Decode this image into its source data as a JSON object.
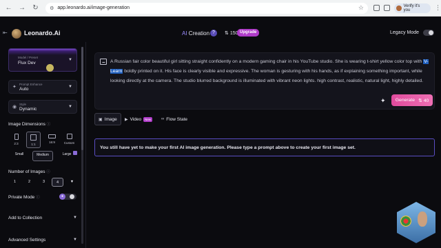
{
  "browser": {
    "url": "app.leonardo.ai/image-generation",
    "profile_label": "Verify it's you"
  },
  "header": {
    "brand": "Leonardo.Ai",
    "ai_prefix": "AI",
    "creation": "Creation",
    "tokens": "150",
    "upgrade": "Upgrade",
    "legacy_mode": "Legacy Mode"
  },
  "sidebar": {
    "model": {
      "label": "Model / Preset",
      "value": "Flux Dev"
    },
    "prompt_enhance": {
      "label": "Prompt Enhance",
      "value": "Auto"
    },
    "style": {
      "label": "Style",
      "value": "Dynamic"
    },
    "image_dimensions": "Image Dimensions",
    "ratios": [
      "2:3",
      "1:1",
      "16:9",
      "Custom"
    ],
    "sizes": [
      {
        "label": "Small",
        "sub": ""
      },
      {
        "label": "Medium",
        "sub": ""
      },
      {
        "label": "Large",
        "sub": ""
      }
    ],
    "number_of_images": "Number of Images",
    "counts": [
      "1",
      "2",
      "3",
      "4"
    ],
    "private_mode": "Private Mode",
    "add_to_collection": "Add to Collection",
    "advanced_settings": "Advanced Settings"
  },
  "prompt": {
    "text_before": "A Russian fair color beautiful girl sitting straight confidently on a modern gaming chair in his YouTube studio. She is wearing t-shirt yellow color top with ",
    "highlight": "V-Learn",
    "text_after": " boldly printed on it. His face is clearly visible and expressive. The woman is gesturing with his hands, as if explaining something important, while looking directly at the camera. The studio blurred background is illuminated with vibrant neon lights. high contrast, realistic, natural light, highly detailed."
  },
  "generate": {
    "label": "Generate",
    "cost": "40"
  },
  "tabs": [
    {
      "label": "Image"
    },
    {
      "label": "Video",
      "badge": "New"
    },
    {
      "label": "Flow State"
    }
  ],
  "banner": "You still have yet to make your first AI image generation. Please type a prompt above to create your first image set.",
  "colors": {
    "accent": "#5b4ec4",
    "generate": "#e04b9d",
    "upgrade": "#b03cc9",
    "background": "#0b0b0f"
  },
  "icons": [
    "back-icon",
    "forward-icon",
    "reload-icon",
    "star-icon",
    "image-icon",
    "magic-wand-icon",
    "lock-icon",
    "help-icon"
  ]
}
